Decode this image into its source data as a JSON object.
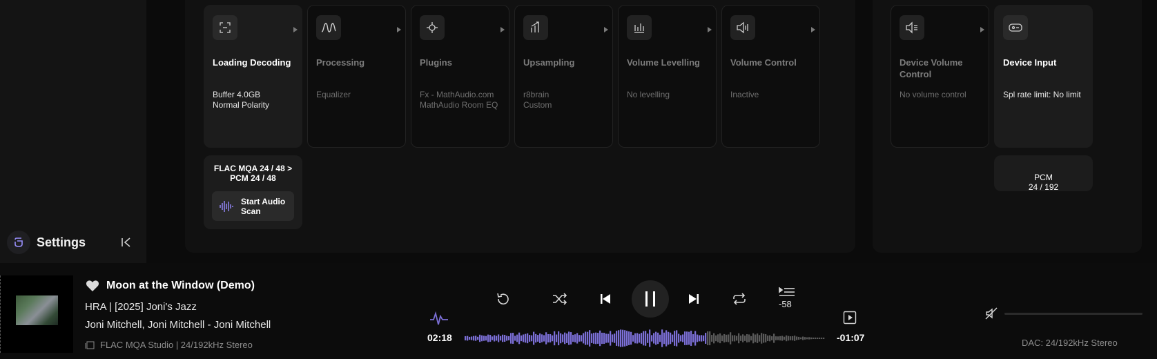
{
  "sidebar": {
    "settings_label": "Settings"
  },
  "pipeline": {
    "main_cards": [
      {
        "title": "Loading Decoding",
        "details": [
          "Buffer 4.0GB",
          "Normal Polarity"
        ],
        "icon": "scan-icon",
        "active": true
      },
      {
        "title": "Processing",
        "details": [
          "Equalizer"
        ],
        "icon": "waveform-icon",
        "active": false
      },
      {
        "title": "Plugins",
        "details": [
          "Fx - MathAudio.com",
          "MathAudio Room EQ"
        ],
        "icon": "plugin-icon",
        "active": false
      },
      {
        "title": "Upsampling",
        "details": [
          "r8brain",
          "Custom"
        ],
        "icon": "upsampling-icon",
        "active": false
      },
      {
        "title": "Volume Levelling",
        "details": [
          "No levelling"
        ],
        "icon": "levels-icon",
        "active": false
      },
      {
        "title": "Volume Control",
        "details": [
          "Inactive"
        ],
        "icon": "speaker-icon",
        "active": false
      }
    ],
    "device_cards": [
      {
        "title": "Device Volume Control",
        "details": [
          "No volume control"
        ],
        "icon": "device-volume-icon",
        "active": false
      },
      {
        "title": "Device Input",
        "details": [
          "Spl rate limit: No limit"
        ],
        "icon": "device-input-icon",
        "active": true
      }
    ],
    "format_conversion": "FLAC MQA 24 / 48 > PCM 24 / 48",
    "scan_button_label": "Start Audio Scan",
    "output_format": "PCM\n24 / 192"
  },
  "player": {
    "title": "Moon at the Window (Demo)",
    "album": "HRA | [2025] Joni's Jazz",
    "artist": "Joni Mitchell, Joni Mitchell - Joni Mitchell",
    "quality": "FLAC MQA Studio | 24/192kHz Stereo",
    "elapsed": "02:18",
    "remaining": "-01:07",
    "skip_silence": "-58",
    "progress": 0.67,
    "dac": "DAC: 24/192kHz Stereo",
    "colors": {
      "accent": "#7b6fd6",
      "waveform_rest": "#5a5a5a"
    }
  }
}
